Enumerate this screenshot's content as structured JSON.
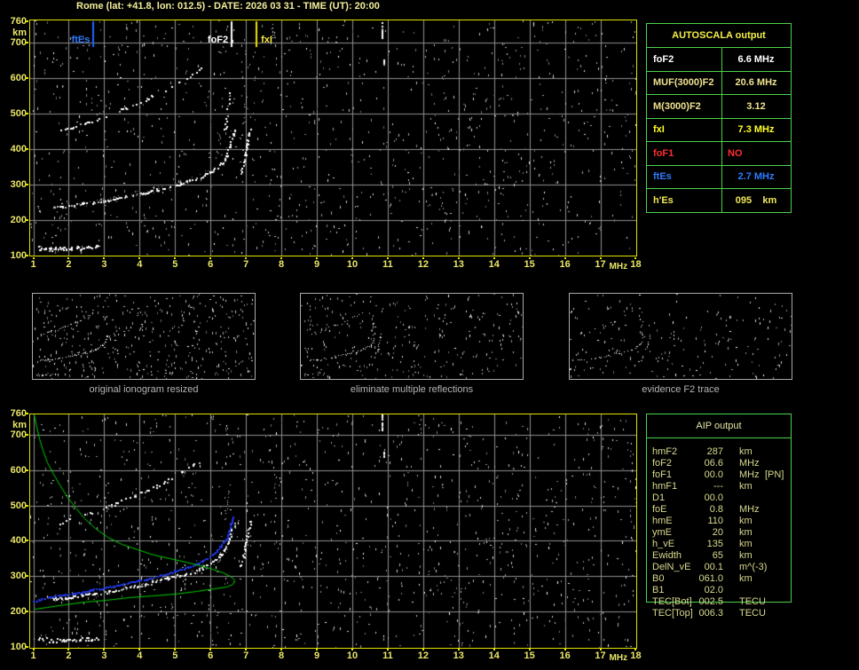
{
  "header": {
    "title": "Rome (lat: +41.8, lon: 012.5) - DATE: 2026 03 31 - TIME (UT): 20:00"
  },
  "colors": {
    "background": "#000000",
    "title_yellow": "#f2ee9a",
    "axis_yellow": "#e9e668",
    "plot_border": "#e3e300",
    "grid_gray": "#8f8f8f",
    "table_green": "#4ad34a",
    "profile_green": "#00d300",
    "fit_blue": "#2038e8",
    "echo_white": "#ffffff",
    "marker_blue": "#1e66ff",
    "marker_white": "#ffffff",
    "marker_yellow": "#f0e400",
    "aip_text": "#d9d98f",
    "caption_gray": "#b4b4b4"
  },
  "autoscala_table": {
    "title": "AUTOSCALA output",
    "rows": [
      {
        "label": "foF2",
        "value": "6.6 MHz",
        "color": "#ffffff"
      },
      {
        "label": "MUF(3000)F2",
        "value": "20.6 MHz",
        "color": "#efe28f"
      },
      {
        "label": "M(3000)F2",
        "value": "3.12",
        "color": "#efe28f"
      },
      {
        "label": "fxI",
        "value": "7.3 MHz",
        "color": "#ffff22"
      },
      {
        "label": "foF1",
        "value": "NO",
        "color": "#ff2d2d",
        "align": "left"
      },
      {
        "label": "ftEs",
        "value": "2.7 MHz",
        "color": "#2e7bff"
      },
      {
        "label": "h'Es",
        "value": "095    km",
        "color": "#f0e85a"
      }
    ]
  },
  "aip_table": {
    "title": "AIP output",
    "rows": [
      {
        "label": "hmF2",
        "value": "287",
        "unit": "km",
        "extra": ""
      },
      {
        "label": "foF2",
        "value": "06.6",
        "unit": "MHz",
        "extra": ""
      },
      {
        "label": "foF1",
        "value": "00.0",
        "unit": "MHz",
        "extra": "[PN]"
      },
      {
        "label": "hmF1",
        "value": "---",
        "unit": "km",
        "extra": ""
      },
      {
        "label": "D1",
        "value": "00.0",
        "unit": "",
        "extra": ""
      },
      {
        "label": "foE",
        "value": "0.8",
        "unit": "MHz",
        "extra": ""
      },
      {
        "label": "hmE",
        "value": "110",
        "unit": "km",
        "extra": ""
      },
      {
        "label": "ymE",
        "value": "20",
        "unit": "km",
        "extra": ""
      },
      {
        "label": "h_vE",
        "value": "135",
        "unit": "km",
        "extra": ""
      },
      {
        "label": "Ewidth",
        "value": "65",
        "unit": "km",
        "extra": ""
      },
      {
        "label": "DelN_vE",
        "value": "00.1",
        "unit": "m^(-3)",
        "extra": ""
      },
      {
        "label": "B0",
        "value": "061.0",
        "unit": "km",
        "extra": ""
      },
      {
        "label": "B1",
        "value": "02.0",
        "unit": "",
        "extra": ""
      },
      {
        "label": "TEC[Bot]",
        "value": "002.5",
        "unit": "TECU",
        "extra": ""
      },
      {
        "label": "TEC[Top]",
        "value": "006.3",
        "unit": "TECU",
        "extra": ""
      }
    ]
  },
  "thumbnails": [
    {
      "caption": "original ionogram resized"
    },
    {
      "caption": "eliminate multiple reflections"
    },
    {
      "caption": "evidence F2 trace"
    }
  ],
  "chart_data": {
    "trace_library": {
      "es": [
        [
          1.15,
          122
        ],
        [
          1.5,
          120
        ],
        [
          1.9,
          121
        ],
        [
          2.3,
          123
        ],
        [
          2.6,
          125
        ],
        [
          2.8,
          126
        ]
      ],
      "hop1": [
        [
          1.5,
          237
        ],
        [
          1.8,
          240
        ],
        [
          2.1,
          243
        ],
        [
          2.4,
          247
        ],
        [
          2.7,
          251
        ],
        [
          3.0,
          256
        ],
        [
          3.3,
          261
        ],
        [
          3.6,
          267
        ],
        [
          3.9,
          273
        ],
        [
          4.2,
          279
        ],
        [
          4.5,
          287
        ],
        [
          4.8,
          295
        ],
        [
          5.1,
          303
        ],
        [
          5.4,
          312
        ],
        [
          5.7,
          322
        ],
        [
          6.0,
          336
        ],
        [
          6.2,
          350
        ],
        [
          6.35,
          366
        ],
        [
          6.45,
          384
        ],
        [
          6.55,
          410
        ],
        [
          6.62,
          436
        ],
        [
          6.67,
          456
        ]
      ],
      "xrise": [
        [
          6.84,
          332
        ],
        [
          6.9,
          356
        ],
        [
          6.96,
          386
        ],
        [
          7.02,
          416
        ],
        [
          7.07,
          442
        ],
        [
          7.11,
          458
        ]
      ],
      "hop2": [
        [
          1.75,
          452
        ],
        [
          2.1,
          463
        ],
        [
          2.45,
          474
        ],
        [
          2.8,
          486
        ],
        [
          3.15,
          499
        ],
        [
          3.5,
          513
        ],
        [
          3.85,
          528
        ],
        [
          4.2,
          543
        ],
        [
          4.55,
          560
        ],
        [
          4.9,
          578
        ],
        [
          5.2,
          596
        ],
        [
          5.5,
          615
        ],
        [
          5.72,
          628
        ]
      ],
      "cusp2a": [
        [
          6.4,
          450
        ],
        [
          6.43,
          478
        ],
        [
          6.46,
          508
        ],
        [
          6.49,
          538
        ],
        [
          6.52,
          562
        ]
      ],
      "cusp2b": [
        [
          6.83,
          420
        ],
        [
          6.88,
          452
        ],
        [
          6.93,
          486
        ],
        [
          6.98,
          520
        ],
        [
          7.02,
          552
        ]
      ],
      "streak_a": [
        [
          10.82,
          758
        ],
        [
          10.82,
          714
        ]
      ],
      "streak_b": [
        [
          10.87,
          652
        ],
        [
          10.87,
          640
        ]
      ],
      "streak_c": [
        [
          3.62,
          752
        ],
        [
          3.62,
          712
        ]
      ],
      "streak_d": [
        [
          7.75,
          752
        ],
        [
          7.75,
          716
        ]
      ],
      "profile_green": [
        [
          1.02,
          757
        ],
        [
          1.08,
          722
        ],
        [
          1.16,
          690
        ],
        [
          1.27,
          656
        ],
        [
          1.4,
          622
        ],
        [
          1.56,
          590
        ],
        [
          1.75,
          558
        ],
        [
          1.95,
          527
        ],
        [
          2.18,
          495
        ],
        [
          2.45,
          464
        ],
        [
          2.75,
          437
        ],
        [
          3.1,
          412
        ],
        [
          3.5,
          392
        ],
        [
          3.95,
          375
        ],
        [
          4.4,
          362
        ],
        [
          4.85,
          350
        ],
        [
          5.3,
          340
        ],
        [
          5.7,
          331
        ],
        [
          6.05,
          322
        ],
        [
          6.35,
          312
        ],
        [
          6.55,
          302
        ],
        [
          6.65,
          293
        ],
        [
          6.68,
          287
        ],
        [
          6.63,
          278
        ],
        [
          6.45,
          271
        ],
        [
          6.1,
          265
        ],
        [
          5.6,
          258
        ],
        [
          5.0,
          251
        ],
        [
          4.35,
          245
        ],
        [
          3.7,
          240
        ],
        [
          3.05,
          234
        ],
        [
          2.45,
          228
        ],
        [
          1.9,
          221
        ],
        [
          1.4,
          214
        ],
        [
          1.05,
          209
        ],
        [
          1.0,
          207
        ]
      ],
      "blue_fit": [
        [
          1.0,
          231
        ],
        [
          1.4,
          240
        ],
        [
          1.8,
          247
        ],
        [
          2.2,
          254
        ],
        [
          2.6,
          261
        ],
        [
          3.0,
          268
        ],
        [
          3.4,
          276
        ],
        [
          3.8,
          285
        ],
        [
          4.2,
          294
        ],
        [
          4.6,
          304
        ],
        [
          5.0,
          315
        ],
        [
          5.35,
          327
        ],
        [
          5.65,
          339
        ],
        [
          5.9,
          352
        ],
        [
          6.1,
          366
        ],
        [
          6.28,
          383
        ],
        [
          6.42,
          404
        ],
        [
          6.52,
          428
        ],
        [
          6.58,
          450
        ],
        [
          6.62,
          470
        ]
      ]
    },
    "plots": [
      {
        "id": "autoscala-ionogram",
        "type": "scatter",
        "x_range": [
          1,
          18
        ],
        "y_range": [
          100,
          760
        ],
        "xlabel": "MHz",
        "ylabel": "km",
        "x_ticks": [
          1,
          2,
          3,
          4,
          5,
          6,
          7,
          8,
          9,
          10,
          11,
          12,
          13,
          14,
          15,
          16,
          17,
          18
        ],
        "y_ticks": [
          760,
          700,
          600,
          500,
          400,
          300,
          200,
          100
        ],
        "grid": {
          "v": [
            1,
            2,
            3,
            4,
            5,
            6,
            7,
            8,
            9,
            10,
            11,
            12,
            13,
            14,
            15,
            16,
            17
          ],
          "h": [
            200,
            300,
            400,
            500,
            600,
            700
          ]
        },
        "markers": [
          {
            "label": "ftEs",
            "f": 2.7,
            "color": "#2e7bff",
            "line": "#1e66ff",
            "side": "left"
          },
          {
            "label": "foF2",
            "f": 6.6,
            "color": "#ffffff",
            "line": "#ffffff",
            "side": "left"
          },
          {
            "label": "fxI",
            "f": 7.3,
            "color": "#f5e93c",
            "line": "#f0e400",
            "side": "right"
          }
        ],
        "traces": [
          {
            "ref": "es",
            "color": "#ffffff",
            "size": 2,
            "step": 1.3,
            "gap": 0.2,
            "jitter": 2.2
          },
          {
            "ref": "hop1",
            "color": "#ffffff",
            "size": 2,
            "step": 1.8,
            "gap": 0.3,
            "jitter": 1.2
          },
          {
            "ref": "hop1",
            "color": "#989898",
            "size": 1,
            "step": 2.2,
            "gap": 0.55,
            "jitter": 4
          },
          {
            "ref": "hop2",
            "color": "#ffffff",
            "size": 2,
            "step": 2.6,
            "gap": 0.5,
            "jitter": 1.4
          },
          {
            "ref": "xrise",
            "color": "#ffffff",
            "size": 2,
            "step": 2,
            "gap": 0.3,
            "jitter": 1
          },
          {
            "ref": "cusp2a",
            "color": "#ffffff",
            "size": 2,
            "step": 2.4,
            "gap": 0.45,
            "jitter": 1
          },
          {
            "ref": "cusp2b",
            "color": "#d8d8d8",
            "size": 1,
            "step": 2.4,
            "gap": 0.5,
            "jitter": 1.2
          },
          {
            "ref": "streak_a",
            "color": "#ffffff",
            "size": 2,
            "step": 2,
            "gap": 0.2,
            "jitter": 0.4
          },
          {
            "ref": "streak_b",
            "color": "#ffffff",
            "size": 2,
            "step": 2,
            "gap": 0.3,
            "jitter": 0.4
          },
          {
            "ref": "streak_c",
            "color": "#cfcfcf",
            "size": 1,
            "step": 2,
            "gap": 0.4,
            "jitter": 0.6
          },
          {
            "ref": "streak_d",
            "color": "#e8e8e8",
            "size": 1,
            "step": 2,
            "gap": 0.4,
            "jitter": 0.6
          }
        ],
        "lines": [],
        "noise": {
          "seed": 1203,
          "count": 1150
        }
      },
      {
        "id": "aip-profile-ionogram",
        "type": "scatter",
        "x_range": [
          1,
          18
        ],
        "y_range": [
          100,
          760
        ],
        "xlabel": "MHz",
        "ylabel": "km",
        "x_ticks": [
          1,
          2,
          3,
          4,
          5,
          6,
          7,
          8,
          9,
          10,
          11,
          12,
          13,
          14,
          15,
          16,
          17,
          18
        ],
        "y_ticks": [
          760,
          700,
          600,
          500,
          400,
          300,
          200,
          100
        ],
        "grid": {
          "v": [
            1,
            2,
            3,
            4,
            5,
            6,
            7,
            8,
            9,
            10,
            11,
            12,
            13,
            14,
            15,
            16,
            17
          ],
          "h": [
            200,
            300,
            400,
            500,
            600,
            700
          ]
        },
        "markers": [],
        "traces": [
          {
            "ref": "es",
            "color": "#ffffff",
            "size": 2,
            "step": 1.3,
            "gap": 0.22,
            "jitter": 2.2
          },
          {
            "ref": "hop1",
            "color": "#ffffff",
            "size": 2,
            "step": 1.8,
            "gap": 0.35,
            "jitter": 1.4
          },
          {
            "ref": "hop1",
            "color": "#989898",
            "size": 1,
            "step": 2.2,
            "gap": 0.6,
            "jitter": 4
          },
          {
            "ref": "hop2",
            "color": "#ffffff",
            "size": 2,
            "step": 2.6,
            "gap": 0.5,
            "jitter": 1.4
          },
          {
            "ref": "xrise",
            "color": "#ffffff",
            "size": 2,
            "step": 2,
            "gap": 0.3,
            "jitter": 1
          },
          {
            "ref": "cusp2a",
            "color": "#cfcfcf",
            "size": 1,
            "step": 2.4,
            "gap": 0.55,
            "jitter": 1
          },
          {
            "ref": "streak_a",
            "color": "#ffffff",
            "size": 2,
            "step": 2,
            "gap": 0.25,
            "jitter": 0.4
          },
          {
            "ref": "streak_b",
            "color": "#ffffff",
            "size": 2,
            "step": 2,
            "gap": 0.3,
            "jitter": 0.4
          },
          {
            "ref": "blue_fit",
            "color": "#2038e8",
            "size": 2,
            "step": 1.6,
            "gap": 0.08,
            "jitter": 0.7
          }
        ],
        "lines": [
          {
            "ref": "profile_green",
            "color": "#00d300",
            "width": 1,
            "name": "electron-density-profile"
          }
        ],
        "noise": {
          "seed": 7741,
          "count": 1250
        }
      },
      {
        "id": "thumb-original",
        "type": "scatter",
        "x_range": [
          1,
          18
        ],
        "y_range": [
          100,
          760
        ],
        "traces": [
          {
            "ref": "es",
            "color": "#ffffff",
            "size": 1,
            "step": 1.5,
            "gap": 0.3,
            "jitter": 1.2
          },
          {
            "ref": "hop1",
            "color": "#ffffff",
            "size": 1,
            "step": 1.6,
            "gap": 0.35,
            "jitter": 0.8
          },
          {
            "ref": "hop2",
            "color": "#e8e8e8",
            "size": 1,
            "step": 2,
            "gap": 0.45,
            "jitter": 0.8
          }
        ],
        "lines": [],
        "noise": {
          "seed": 991,
          "count": 430
        }
      },
      {
        "id": "thumb-no-multiples",
        "type": "scatter",
        "x_range": [
          1,
          18
        ],
        "y_range": [
          100,
          760
        ],
        "traces": [
          {
            "ref": "es",
            "color": "#e8e8e8",
            "size": 1,
            "step": 2,
            "gap": 0.45,
            "jitter": 1.2
          },
          {
            "ref": "hop1",
            "color": "#ffffff",
            "size": 1,
            "step": 1.6,
            "gap": 0.4,
            "jitter": 0.8
          },
          {
            "ref": "hop2",
            "color": "#e0e0e0",
            "size": 1,
            "step": 2.4,
            "gap": 0.55,
            "jitter": 0.8
          },
          {
            "ref": "cusp2a",
            "color": "#ffffff",
            "size": 1,
            "step": 2,
            "gap": 0.4,
            "jitter": 0.8
          },
          {
            "ref": "xrise",
            "color": "#ffffff",
            "size": 1,
            "step": 2,
            "gap": 0.4,
            "jitter": 0.8
          }
        ],
        "lines": [],
        "noise": {
          "seed": 552,
          "count": 300
        }
      },
      {
        "id": "thumb-f2-trace",
        "type": "scatter",
        "x_range": [
          1,
          18
        ],
        "y_range": [
          100,
          760
        ],
        "traces": [
          {
            "ref": "hop1",
            "color": "#ffffff",
            "size": 1,
            "step": 2,
            "gap": 0.55,
            "jitter": 0.8
          },
          {
            "ref": "hop2",
            "color": "#ffffff",
            "size": 1,
            "step": 2.6,
            "gap": 0.6,
            "jitter": 0.8
          },
          {
            "ref": "cusp2a",
            "color": "#ffffff",
            "size": 1,
            "step": 2,
            "gap": 0.45,
            "jitter": 0.8
          },
          {
            "ref": "xrise",
            "color": "#e8e8e8",
            "size": 1,
            "step": 2.2,
            "gap": 0.5,
            "jitter": 0.8
          }
        ],
        "lines": [],
        "noise": {
          "seed": 313,
          "count": 210
        }
      }
    ]
  }
}
